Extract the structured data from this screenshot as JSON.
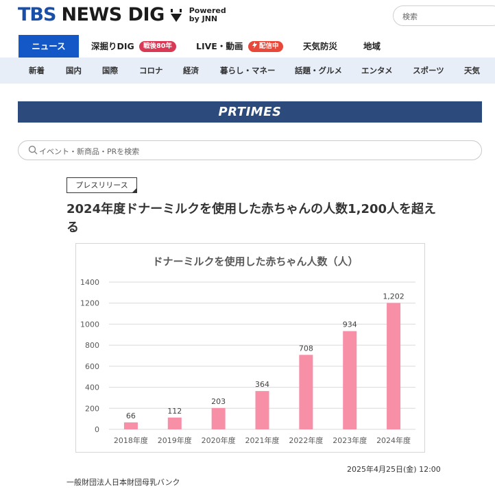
{
  "header": {
    "logo_tbs": "TBS",
    "logo_news": "NEWS DIG",
    "powered_line1": "Powered",
    "powered_line2": "by JNN",
    "search_placeholder": "検索"
  },
  "nav_primary": [
    {
      "label": "ニュース",
      "active": true
    },
    {
      "label": "深掘りDIG",
      "badge": "戦後80年"
    },
    {
      "label": "LIVE・動画",
      "badge": "配信中"
    },
    {
      "label": "天気防災"
    },
    {
      "label": "地域"
    }
  ],
  "nav_secondary": [
    "新着",
    "国内",
    "国際",
    "コロナ",
    "経済",
    "暮らし・マネー",
    "話題・グルメ",
    "エンタメ",
    "スポーツ",
    "天気"
  ],
  "prtimes": {
    "banner": "PRTIMES",
    "search_placeholder": "イベント・新商品・PRを検索"
  },
  "article": {
    "tag": "プレスリリース",
    "title": "2024年度ドナーミルクを使用した赤ちゃんの人数1,200人を超える",
    "date": "2025年4月25日(金) 12:00",
    "company": "一般財団法人日本財団母乳バンク"
  },
  "colors": {
    "brand_blue": "#1458c7",
    "prtimes_navy": "#2c4b7c",
    "bar_pink": "#f78fa7",
    "nav_bg": "#e7eef8"
  },
  "chart_data": {
    "type": "bar",
    "title": "ドナーミルクを使用した赤ちゃん人数（人）",
    "categories": [
      "2018年度",
      "2019年度",
      "2020年度",
      "2021年度",
      "2022年度",
      "2023年度",
      "2024年度"
    ],
    "values": [
      66,
      112,
      203,
      364,
      708,
      934,
      1202
    ],
    "value_labels": [
      "66",
      "112",
      "203",
      "364",
      "708",
      "934",
      "1,202"
    ],
    "ylim": [
      0,
      1400
    ],
    "yticks": [
      0,
      200,
      400,
      600,
      800,
      1000,
      1200,
      1400
    ],
    "grid": true,
    "xlabel": "",
    "ylabel": ""
  }
}
